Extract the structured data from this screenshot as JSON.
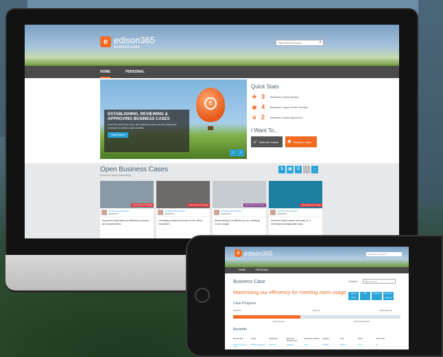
{
  "app": {
    "logo_mark": "e",
    "logo_name": "edison365",
    "logo_tag": "business case",
    "search_placeholder": "Type here to search"
  },
  "nav": {
    "home": "HOME",
    "personal": "PERSONAL"
  },
  "hero": {
    "title": "ESTABLISHING, REVIEWING & APPROVING BUSINESS CASES",
    "description": "From the seed of an idea, firm business cases can be edited and reviewed to achieve solid benefits.",
    "read_more": "Read More",
    "prev": "‹",
    "next": "›"
  },
  "quick_stats": {
    "title": "Quick Stats",
    "items": [
      {
        "icon": "puzzle-icon",
        "count": "3",
        "label": "Business Cases Added"
      },
      {
        "icon": "briefcase-icon",
        "count": "4",
        "label": "Business Cases Under Review"
      },
      {
        "icon": "trophy-icon",
        "count": "2",
        "label": "Business Cases Approved"
      }
    ]
  },
  "want_to": {
    "title": "I Want To...",
    "discover": "Discover Cases",
    "submit": "Submit a Case"
  },
  "open_cases": {
    "title": "Open Business Cases",
    "subtitle": "Sorted by Views (Ascending)",
    "cards": [
      {
        "tag": "New Approved Target",
        "author": "JOSEPH MCCARRON",
        "date": "02/06/2017",
        "text": "Improved operational efficiency across all departments",
        "img_color": "#8a9aa4",
        "tag_color": "#e0353d"
      },
      {
        "tag": "New Approved Target",
        "author": "JOSEPH MCCARRON",
        "date": "02/06/2017",
        "text": "Creating breakout areas in the office reception",
        "img_color": "#6d6a6a",
        "tag_color": "#e0353d"
      },
      {
        "tag": "New Approved Target",
        "author": "JOSEPH MCCARRON",
        "date": "02/06/2017",
        "text": "Maximising our efficiency for meeting room usage",
        "img_color": "#c7ccd1",
        "tag_color": "#8a3a8a"
      },
      {
        "tag": "New Approved Target",
        "author": "JOSEPH MCCARRON",
        "date": "02/06/2017",
        "text": "Improve web-based security in a centrally manageable way...",
        "img_color": "#1d7fa2",
        "tag_color": "#e0353d"
      }
    ]
  },
  "mobile": {
    "nav_home": "HOME",
    "nav_personal": "PERSONAL",
    "section": "Business Case",
    "version_label": "Version",
    "version_value": "SEE versions",
    "headline": "Maximising our efficiency for meeting room usage",
    "actions": [
      "Save & Close",
      "Edit",
      "Workflow",
      "Submit for Approval"
    ],
    "progress_title": "Case Progress",
    "stages": [
      "Submitted",
      "Open Approval",
      "Approved",
      "Under Consideration",
      "Board Approved"
    ],
    "progress_fraction": 0.4,
    "benefits_title": "Benefits",
    "columns": [
      "Benefit name",
      "Owner",
      "Target Date",
      "Method of Measurement",
      "Estimation (value £)",
      "Category",
      "Freq.",
      "Status",
      "Grand Total"
    ],
    "row": [
      "Reduced meeting room...",
      "William Humphries",
      "31/07/18",
      "Schedule",
      "N/A",
      "Tangible",
      "Monthly",
      "Open",
      "£0"
    ]
  }
}
